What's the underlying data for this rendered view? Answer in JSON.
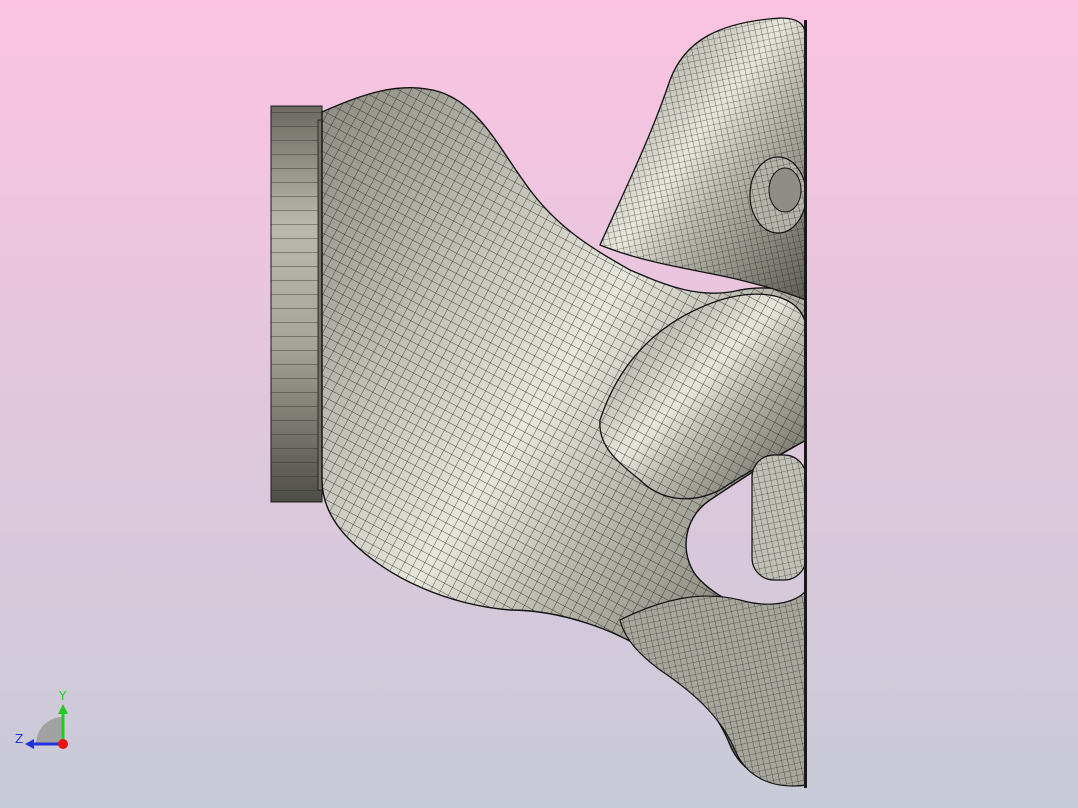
{
  "viewport": {
    "background_top": "#fbc3e1",
    "background_bottom": "#c8cbd8",
    "mesh_fill": "#c8c8be",
    "mesh_line": "#1e1e1e"
  },
  "axis_triad": {
    "y_label": "Y",
    "z_label": "Z",
    "y_color": "#22cc22",
    "z_color": "#2233dd",
    "x_color": "#ee1111"
  }
}
